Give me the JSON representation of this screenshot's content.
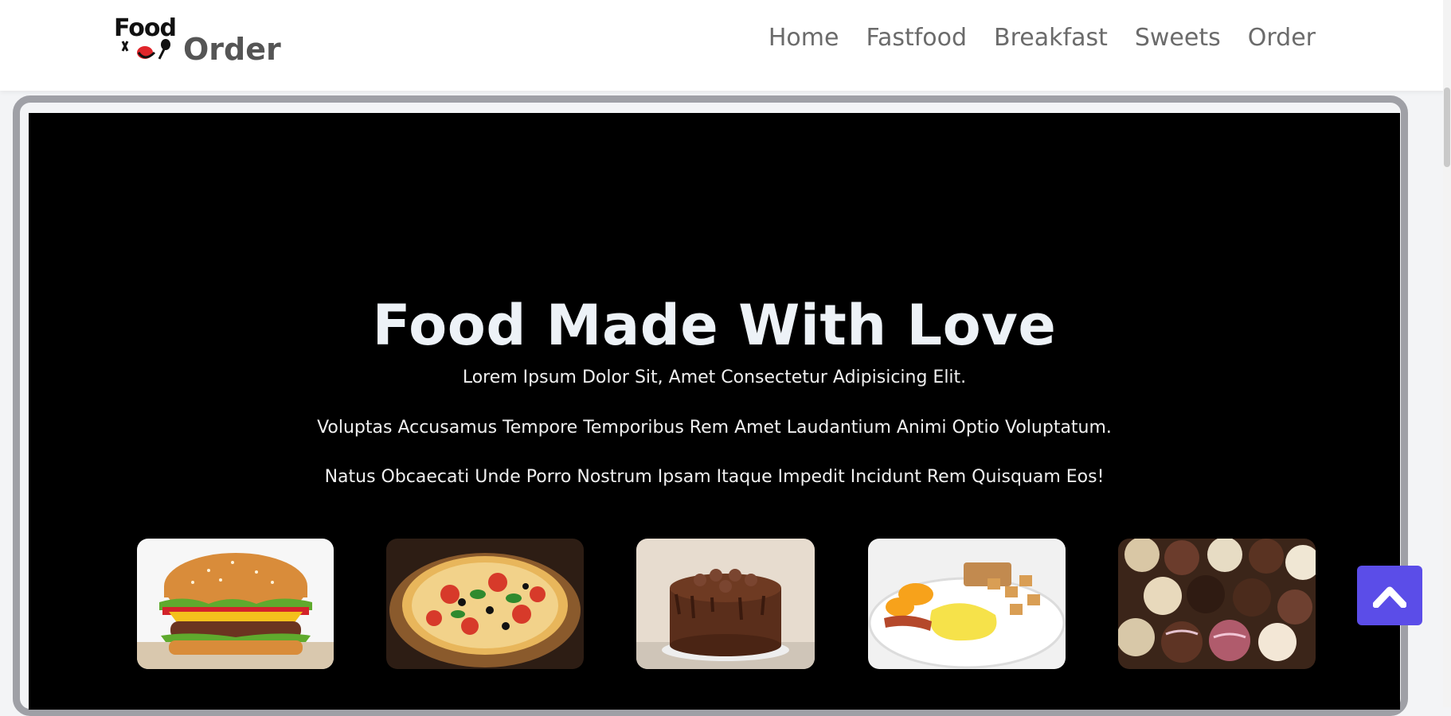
{
  "brand": {
    "logo_word": "Food",
    "name": "Order"
  },
  "nav": {
    "items": [
      {
        "label": "Home"
      },
      {
        "label": "Fastfood"
      },
      {
        "label": "Breakfast"
      },
      {
        "label": "Sweets"
      },
      {
        "label": "Order"
      }
    ]
  },
  "hero": {
    "title": "Food Made With Love",
    "lines": [
      "Lorem Ipsum Dolor Sit, Amet Consectetur Adipisicing Elit.",
      "Voluptas Accusamus Tempore Temporibus Rem Amet Laudantium Animi Optio Voluptatum.",
      "Natus Obcaecati Unde Porro Nostrum Ipsam Itaque Impedit Incidunt Rem Quisquam Eos!"
    ]
  },
  "thumbnails": [
    {
      "icon": "burger-image"
    },
    {
      "icon": "pizza-image"
    },
    {
      "icon": "chocolate-cake-image"
    },
    {
      "icon": "breakfast-plate-image"
    },
    {
      "icon": "chocolate-truffles-image"
    }
  ],
  "colors": {
    "hero_bg": "#000000",
    "frame_border": "#9fa0a6",
    "back_to_top": "#5b4de8",
    "nav_text": "#6b6b6b",
    "title_text": "#edf2f7"
  }
}
